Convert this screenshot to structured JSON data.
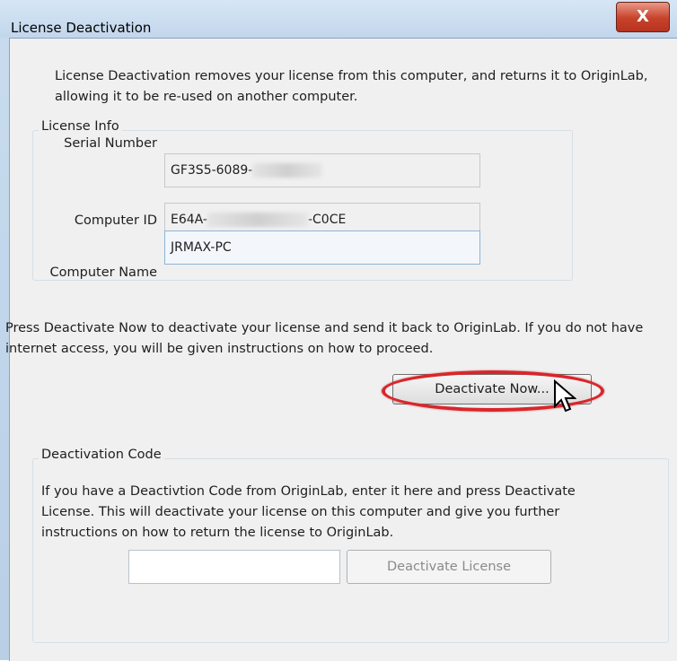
{
  "window": {
    "title": "License Deactivation",
    "close_glyph": "X"
  },
  "intro_text": "License Deactivation removes your license from this computer, and returns it to OriginLab, allowing it to be re-used on another computer.",
  "license_info": {
    "legend": "License Info",
    "serial_label": "Serial Number",
    "serial_value": "GF3S5-6089-",
    "computer_id_label": "Computer ID",
    "computer_id_prefix": "E64A-",
    "computer_id_suffix": "-C0CE",
    "computer_name_label": "Computer Name",
    "computer_name_value": "JRMAX-PC"
  },
  "deactivate_instructions": "Press Deactivate Now to deactivate your license and send it back to OriginLab. If you do not have internet access, you will be given instructions on how to proceed.",
  "deactivate_now_button": "Deactivate Now...",
  "deactivation_code": {
    "legend": "Deactivation Code",
    "text": "If you have a Deactivtion Code from OriginLab, enter it here and press Deactivate License. This will deactivate your license on this computer and give you further instructions on how to return the license to OriginLab.",
    "input_value": "",
    "button": "Deactivate License"
  },
  "colors": {
    "highlight": "#d9262b",
    "close_button": "#c7422a"
  }
}
